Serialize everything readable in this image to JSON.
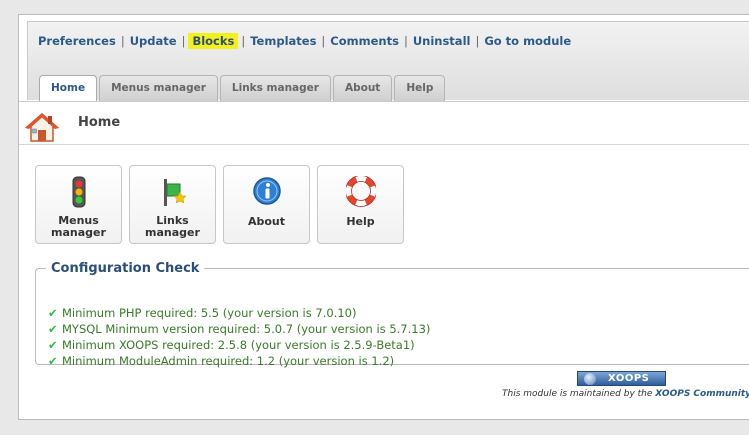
{
  "top_menu": {
    "items": [
      {
        "label": "Preferences"
      },
      {
        "label": "Update"
      },
      {
        "label": "Blocks"
      },
      {
        "label": "Templates"
      },
      {
        "label": "Comments"
      },
      {
        "label": "Uninstall"
      },
      {
        "label": "Go to module"
      }
    ],
    "separator": "|"
  },
  "tabs": [
    {
      "label": "Home"
    },
    {
      "label": "Menus manager"
    },
    {
      "label": "Links manager"
    },
    {
      "label": "About"
    },
    {
      "label": "Help"
    }
  ],
  "header": {
    "title": "Home",
    "icon": "home-icon"
  },
  "icon_buttons": [
    {
      "label_line1": "Menus",
      "label_line2": "manager",
      "icon": "traffic-light-icon"
    },
    {
      "label_line1": "Links",
      "label_line2": "manager",
      "icon": "links-icon"
    },
    {
      "label": "About",
      "icon": "info-icon"
    },
    {
      "label": "Help",
      "icon": "lifebuoy-icon"
    }
  ],
  "config_check": {
    "title": "Configuration Check",
    "items": [
      {
        "text": "Minimum PHP required: 5.5 (your version is 7.0.10)"
      },
      {
        "text": "MYSQL Minimum version required: 5.0.7 (your version is 5.7.13)"
      },
      {
        "text": "Minimum XOOPS required: 2.5.8 (your version is 2.5.9-Beta1)"
      },
      {
        "text": "Minimum ModuleAdmin required: 1.2 (your version is 1.2)"
      }
    ]
  },
  "footer": {
    "badge": "XOOPS",
    "maintained_text": "This module is maintained by the",
    "community_link": "XOOPS Community"
  },
  "colors": {
    "link": "#2b5a8a",
    "highlight": "#f3f01c",
    "check_text": "#3a7a2a",
    "check_icon": "#3bb54a"
  }
}
